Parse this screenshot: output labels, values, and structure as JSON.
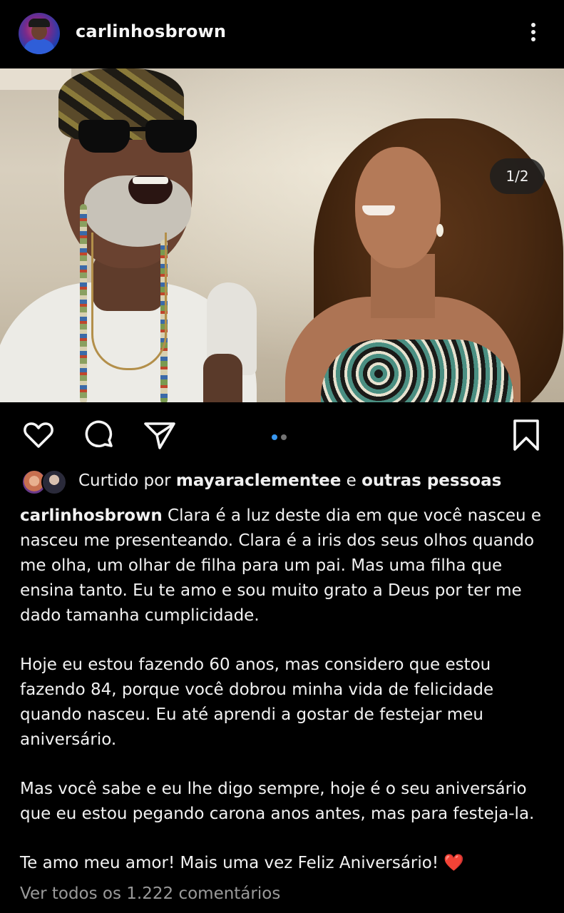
{
  "header": {
    "username": "carlinhosbrown",
    "more_icon": "more-vertical-icon"
  },
  "post": {
    "image_counter": "1/2",
    "carousel": {
      "current": 1,
      "total": 2
    },
    "tag_icon": "user-tag-icon"
  },
  "actions": {
    "like_icon": "heart-icon",
    "comment_icon": "comment-icon",
    "share_icon": "send-icon",
    "save_icon": "bookmark-icon"
  },
  "likes": {
    "prefix": "Curtido por ",
    "user": "mayaraclementee",
    "connector": " e ",
    "others": "outras pessoas"
  },
  "caption": {
    "username": "carlinhosbrown",
    "paragraph1": "Clara é a luz deste dia em que você nasceu e nasceu me presenteando. Clara é a iris dos seus olhos quando me olha, um olhar de filha para um pai. Mas uma filha que ensina tanto. Eu te amo e sou muito grato a Deus por ter me dado tamanha cumplicidade.",
    "paragraph2": "Hoje eu estou fazendo 60 anos, mas considero que estou fazendo 84, porque você dobrou minha vida de felicidade quando nasceu. Eu até aprendi a gostar de festejar meu aniversário.",
    "paragraph3": "Mas você sabe e eu lhe digo sempre, hoje é o seu aniversário que eu estou pegando carona anos antes, mas para festeja-la.",
    "paragraph4": "Te amo meu amor! Mais uma vez Feliz Aniversário! ",
    "emoji": "❤️"
  },
  "comments": {
    "view_all": "Ver todos os 1.222 comentários"
  },
  "colors": {
    "background": "#000000",
    "text": "#f2f2f2",
    "muted": "#9a9a9a",
    "dot_active": "#3897f0",
    "dot_inactive": "#737373",
    "heart": "#e0202e"
  }
}
